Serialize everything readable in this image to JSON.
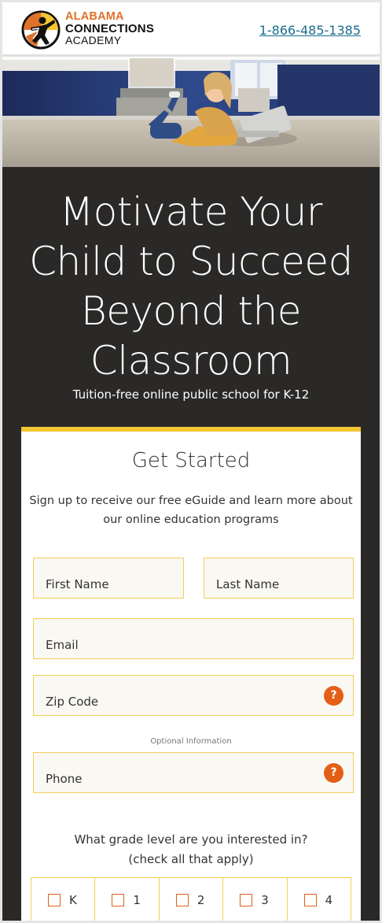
{
  "header": {
    "logo_line1": "ALABAMA",
    "logo_line2": "CONNECTIONS",
    "logo_line3": "ACADEMY",
    "phone": "1-866-485-1385"
  },
  "hero": {
    "image_icon": "girl-with-laptop-photo",
    "headline_lines": [
      "Motivate Your",
      "Child to Succeed",
      "Beyond the",
      "Classroom"
    ],
    "subline": "Tuition-free online public school for K-12"
  },
  "form": {
    "title": "Get Started",
    "intro": "Sign up to receive our free eGuide and learn more about our online education programs",
    "first_name_placeholder": "First Name",
    "last_name_placeholder": "Last Name",
    "email_placeholder": "Email",
    "zip_placeholder": "Zip Code",
    "help_symbol": "?",
    "optional_label": "Optional Information",
    "phone_placeholder": "Phone",
    "grade_question_line1": "What grade level are you interested in?",
    "grade_question_line2": "(check all that apply)",
    "grades": [
      "K",
      "1",
      "2",
      "3",
      "4"
    ]
  },
  "colors": {
    "brand_orange": "#e0712a",
    "accent_orange": "#e35e16",
    "accent_yellow": "#f5c631",
    "link_blue": "#1a6c8e",
    "hero_bg": "#2a2928"
  }
}
